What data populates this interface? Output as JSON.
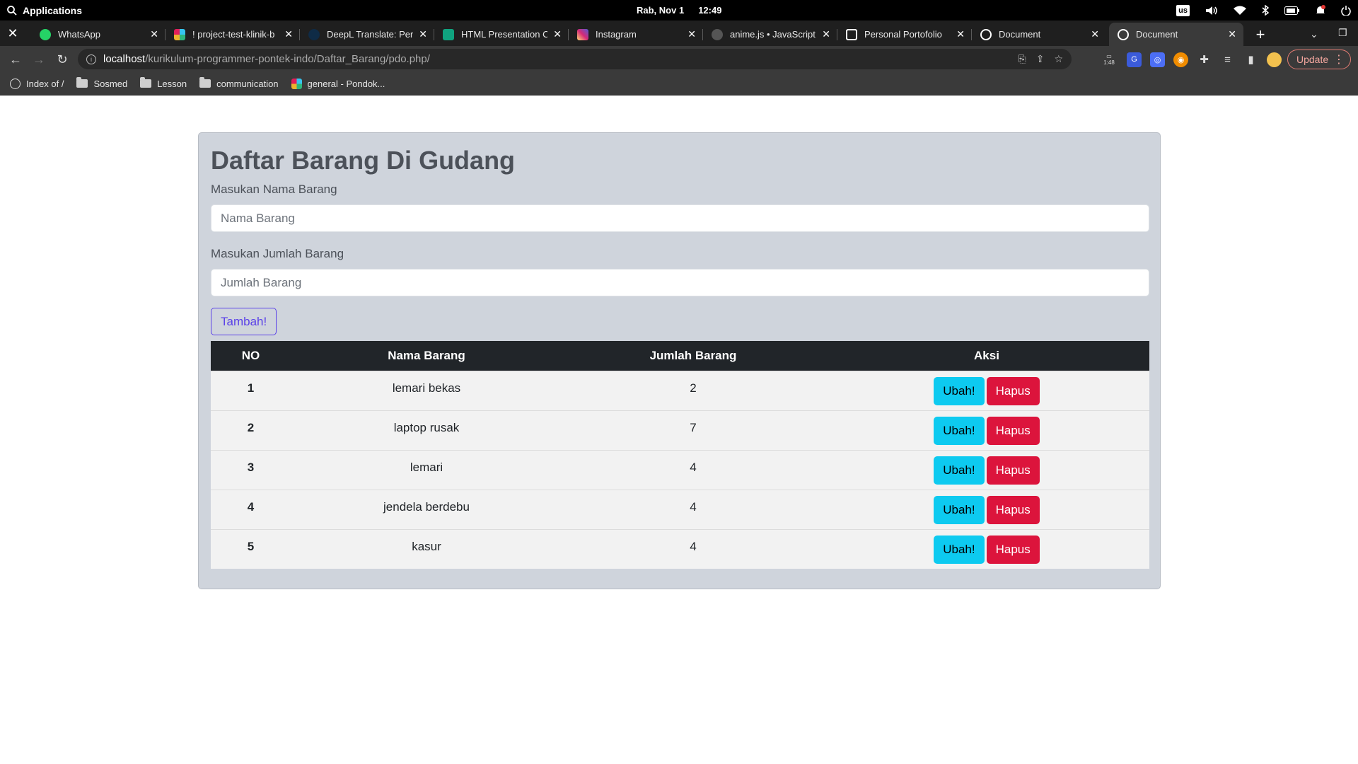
{
  "os": {
    "apps_label": "Applications",
    "day": "Rab, Nov 1",
    "time": "12:49",
    "keyboard": "us"
  },
  "tabs": [
    {
      "title": "WhatsApp",
      "icon": "whatsapp-icon",
      "color": "#25d366"
    },
    {
      "title": "! project-test-klinik-b",
      "icon": "slack-icon",
      "color": "#e01e5a"
    },
    {
      "title": "DeepL Translate: Per",
      "icon": "deepl-icon",
      "color": "#0f2b46"
    },
    {
      "title": "HTML Presentation C",
      "icon": "chatgpt-icon",
      "color": "#10a37f"
    },
    {
      "title": "Instagram",
      "icon": "instagram-icon",
      "color": "#e1306c"
    },
    {
      "title": "anime.js • JavaScript",
      "icon": "animejs-icon",
      "color": "#444444"
    },
    {
      "title": "Personal Portofolio",
      "icon": "codepen-icon",
      "color": "#ffffff"
    },
    {
      "title": "Document",
      "icon": "globe-icon",
      "color": "#ffffff"
    },
    {
      "title": "Document",
      "icon": "globe-icon",
      "color": "#ffffff"
    }
  ],
  "address": {
    "host": "localhost",
    "path": "/kurikulum-programmer-pontek-indo/Daftar_Barang/pdo.php/"
  },
  "ext_badge": "1:48",
  "update_label": "Update",
  "bookmarks": [
    "Index of /",
    "Sosmed",
    "Lesson",
    "communication",
    "general - Pondok..."
  ],
  "page": {
    "title": "Daftar Barang Di Gudang",
    "name_label": "Masukan Nama Barang",
    "name_placeholder": "Nama Barang",
    "qty_label": "Masukan Jumlah Barang",
    "qty_placeholder": "Jumlah Barang",
    "add_button": "Tambah!",
    "table": {
      "headers": [
        "NO",
        "Nama Barang",
        "Jumlah Barang",
        "Aksi"
      ],
      "rows": [
        {
          "no": "1",
          "nama": "lemari bekas",
          "jumlah": "2"
        },
        {
          "no": "2",
          "nama": "laptop rusak",
          "jumlah": "7"
        },
        {
          "no": "3",
          "nama": "lemari",
          "jumlah": "4"
        },
        {
          "no": "4",
          "nama": "jendela berdebu",
          "jumlah": "4"
        },
        {
          "no": "5",
          "nama": "kasur",
          "jumlah": "4"
        }
      ],
      "edit_label": "Ubah!",
      "delete_label": "Hapus"
    }
  }
}
